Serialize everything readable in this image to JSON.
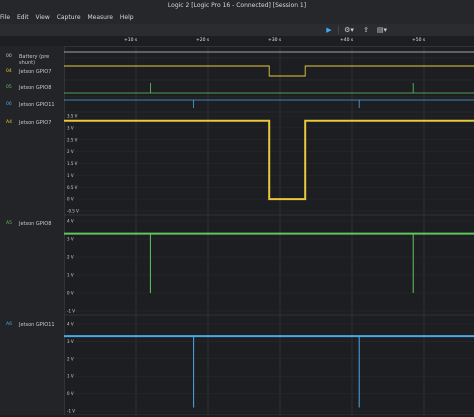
{
  "window": {
    "title": "Logic 2 [Logic Pro 16 - Connected] [Session 1]"
  },
  "menu": [
    {
      "label": "File"
    },
    {
      "label": "Edit"
    },
    {
      "label": "View"
    },
    {
      "label": "Capture"
    },
    {
      "label": "Measure"
    },
    {
      "label": "Help"
    }
  ],
  "toolbar": {
    "play_icon": "play-icon",
    "settings_icon": "gear-icon",
    "share_icon": "share-icon",
    "layout_icon": "layout-icon"
  },
  "timeline": {
    "ticks": [
      "+10 s",
      "+20 s",
      "+30 s",
      "+40 s",
      "+50 s"
    ]
  },
  "digital_channels": [
    {
      "num": "00",
      "name": "Battery (pre shunt)",
      "color": "#d0d0d0"
    },
    {
      "num": "04",
      "name": "Jetson GPIO7",
      "color": "#e8c840"
    },
    {
      "num": "05",
      "name": "Jetson GPIO8",
      "color": "#5ec85e"
    },
    {
      "num": "06",
      "name": "Jetson GPIO11",
      "color": "#4aa8e8"
    }
  ],
  "analog_channels": [
    {
      "num": "A4",
      "name": "Jetson GPIO7",
      "color": "#e8c840",
      "y_labels": [
        "3.5 V",
        "3 V",
        "2.5 V",
        "2 V",
        "1.5 V",
        "1 V",
        "0.5 V",
        "0 V",
        "-0.5 V"
      ],
      "high_v": 3.3,
      "low_v": 0.0,
      "dip_start_s": 28.5,
      "dip_end_s": 33.5
    },
    {
      "num": "A5",
      "name": "Jetson GPIO8",
      "color": "#5ec85e",
      "y_labels": [
        "4 V",
        "3 V",
        "2 V",
        "1 V",
        "0 V",
        "-1 V"
      ],
      "high_v": 3.3,
      "low_v": 0.0,
      "pulses_s": [
        12,
        48.5
      ]
    },
    {
      "num": "A6",
      "name": "Jetson GPIO11",
      "color": "#4aa8e8",
      "y_labels": [
        "4 V",
        "3 V",
        "2 V",
        "1 V",
        "0 V",
        "-1 V"
      ],
      "high_v": 3.3,
      "low_v": -0.8,
      "pulses_s": [
        18,
        41
      ]
    }
  ]
}
